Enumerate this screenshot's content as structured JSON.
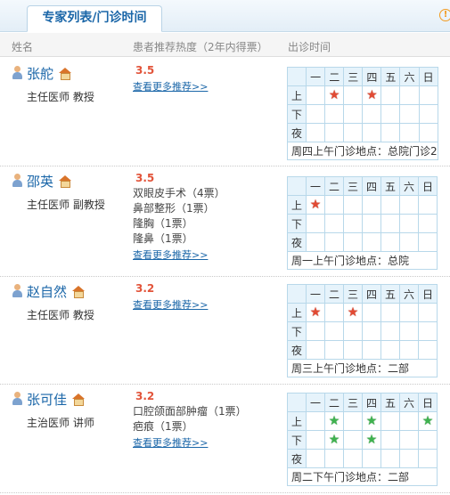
{
  "tab": {
    "label": "专家列表/门诊时间"
  },
  "columns": {
    "name": "姓名",
    "hotness": "患者推荐热度（2年内得票）",
    "clinic": "出诊时间"
  },
  "schedule_days": [
    "一",
    "二",
    "三",
    "四",
    "五",
    "六",
    "日"
  ],
  "schedule_periods": [
    "上",
    "下",
    "夜"
  ],
  "colors": {
    "red_star": "#e24a33",
    "green_star": "#3fb24f",
    "link": "#1a66a8",
    "score": "#e2543a"
  },
  "doctors": [
    {
      "name": "张舵",
      "title": "主任医师  教授",
      "score": "3.5",
      "recommendations": [],
      "more_link": "查看更多推荐>>",
      "slots": {
        "上": {
          "二": "red",
          "四": "red"
        },
        "下": {},
        "夜": {}
      },
      "clinic_note": "周四上午门诊地点：总院门诊2"
    },
    {
      "name": "邵英",
      "title": "主任医师  副教授",
      "score": "3.5",
      "recommendations": [
        "双眼皮手术（4票）",
        "鼻部整形（1票）",
        "隆胸（1票）",
        "隆鼻（1票）"
      ],
      "more_link": "查看更多推荐>>",
      "slots": {
        "上": {
          "一": "red"
        },
        "下": {},
        "夜": {}
      },
      "clinic_note": "周一上午门诊地点：总院"
    },
    {
      "name": "赵自然",
      "title": "主任医师  教授",
      "score": "3.2",
      "recommendations": [],
      "more_link": "查看更多推荐>>",
      "slots": {
        "上": {
          "一": "red",
          "三": "red"
        },
        "下": {},
        "夜": {}
      },
      "clinic_note": "周三上午门诊地点：二部"
    },
    {
      "name": "张可佳",
      "title": "主治医师  讲师",
      "score": "3.2",
      "recommendations": [
        "口腔颌面部肿瘤（1票）",
        "疤痕（1票）"
      ],
      "more_link": "查看更多推荐>>",
      "slots": {
        "上": {
          "二": "green",
          "四": "green",
          "日": "green"
        },
        "下": {
          "二": "green",
          "四": "green"
        },
        "夜": {}
      },
      "clinic_note": "周二下午门诊地点：二部"
    }
  ]
}
